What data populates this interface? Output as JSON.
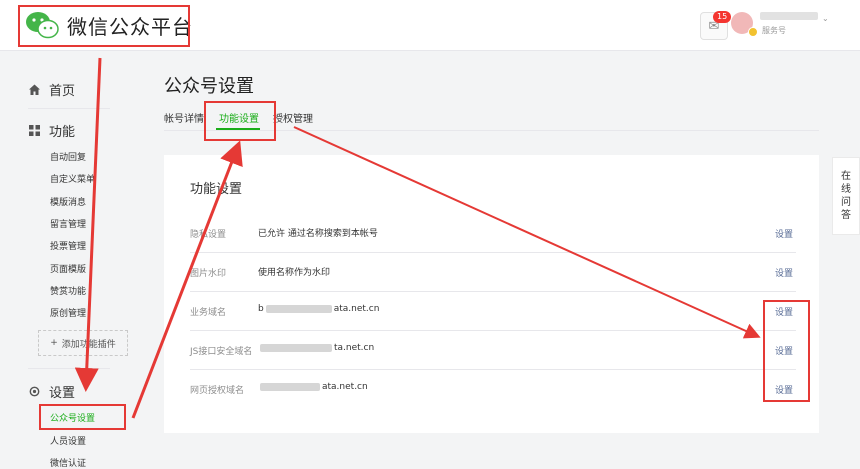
{
  "header": {
    "brand": "微信公众平台",
    "notification_count": "15",
    "account_type": "服务号",
    "chevron": "⌄"
  },
  "sidebar": {
    "home": "首页",
    "features": {
      "label": "功能",
      "items": [
        "自动回复",
        "自定义菜单",
        "模版消息",
        "留言管理",
        "投票管理",
        "页面模版",
        "赞赏功能",
        "原创管理"
      ]
    },
    "add_plugin": "添加功能插件",
    "settings": {
      "label": "设置",
      "items": [
        "公众号设置",
        "人员设置",
        "微信认证"
      ]
    }
  },
  "main": {
    "title": "公众号设置",
    "tabs": [
      "帐号详情",
      "功能设置",
      "授权管理"
    ],
    "card_title": "功能设置",
    "rows": [
      {
        "label": "隐私设置",
        "value": "已允许 通过名称搜索到本帐号",
        "action": "设置"
      },
      {
        "label": "图片水印",
        "value": "使用名称作为水印",
        "action": "设置"
      },
      {
        "label": "业务域名",
        "value_prefix": "b",
        "value_suffix": "ata.net.cn",
        "action": "设置"
      },
      {
        "label": "JS接口安全域名",
        "value_prefix": "",
        "value_suffix": "ta.net.cn",
        "action": "设置"
      },
      {
        "label": "网页授权域名",
        "value_prefix": "",
        "value_suffix": "ata.net.cn",
        "action": "设置"
      }
    ]
  },
  "side_help": [
    "在",
    "线",
    "问",
    "答"
  ],
  "colors": {
    "accent": "#1aad19",
    "link": "#576b95",
    "highlight": "#e53935"
  }
}
